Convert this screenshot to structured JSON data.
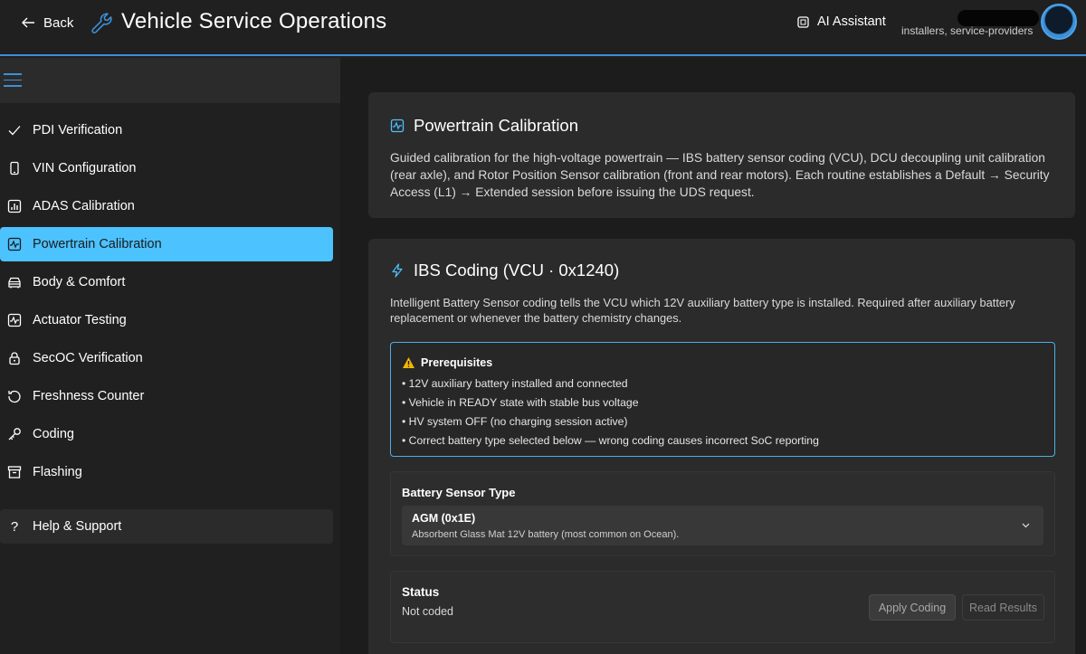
{
  "header": {
    "back_label": "Back",
    "app_title": "Vehicle Service Operations",
    "ai_assistant_label": "AI Assistant",
    "user_role": "installers, service-providers",
    "accent_color": "#3d8fd6"
  },
  "sidebar": {
    "items": [
      {
        "label": "PDI Verification",
        "icon": "check-icon"
      },
      {
        "label": "VIN Configuration",
        "icon": "phone-icon"
      },
      {
        "label": "ADAS Calibration",
        "icon": "chart-icon"
      },
      {
        "label": "Powertrain Calibration",
        "icon": "pulse-icon",
        "active": true
      },
      {
        "label": "Body & Comfort",
        "icon": "car-icon"
      },
      {
        "label": "Actuator Testing",
        "icon": "pulse-box-icon"
      },
      {
        "label": "SecOC Verification",
        "icon": "lock-icon"
      },
      {
        "label": "Freshness Counter",
        "icon": "refresh-icon"
      },
      {
        "label": "Coding",
        "icon": "key-icon"
      },
      {
        "label": "Flashing",
        "icon": "archive-icon"
      }
    ],
    "help_label": "Help & Support",
    "active_color": "#4cc2ff"
  },
  "main": {
    "overview": {
      "title": "Powertrain Calibration",
      "description": "Guided calibration for the high-voltage powertrain — IBS battery sensor coding (VCU), DCU decoupling unit calibration (rear axle), and Rotor Position Sensor calibration (front and rear motors). Each routine establishes a Default → Security Access (L1) → Extended session before issuing the UDS request."
    },
    "ibs": {
      "title": "IBS Coding (VCU · 0x1240)",
      "description": "Intelligent Battery Sensor coding tells the VCU which 12V auxiliary battery type is installed. Required after auxiliary battery replacement or whenever the battery chemistry changes.",
      "prereq_title": "Prerequisites",
      "prereqs": [
        "12V auxiliary battery installed and connected",
        "Vehicle in READY state with stable bus voltage",
        "HV system OFF (no charging session active)",
        "Correct battery type selected below — wrong coding causes incorrect SoC reporting"
      ],
      "sensor_label": "Battery Sensor Type",
      "sensor_value": "AGM (0x1E)",
      "sensor_desc": "Absorbent Glass Mat 12V battery (most common on Ocean).",
      "status_label": "Status",
      "status_value": "Not coded",
      "apply_label": "Apply Coding",
      "read_label": "Read Results"
    }
  }
}
